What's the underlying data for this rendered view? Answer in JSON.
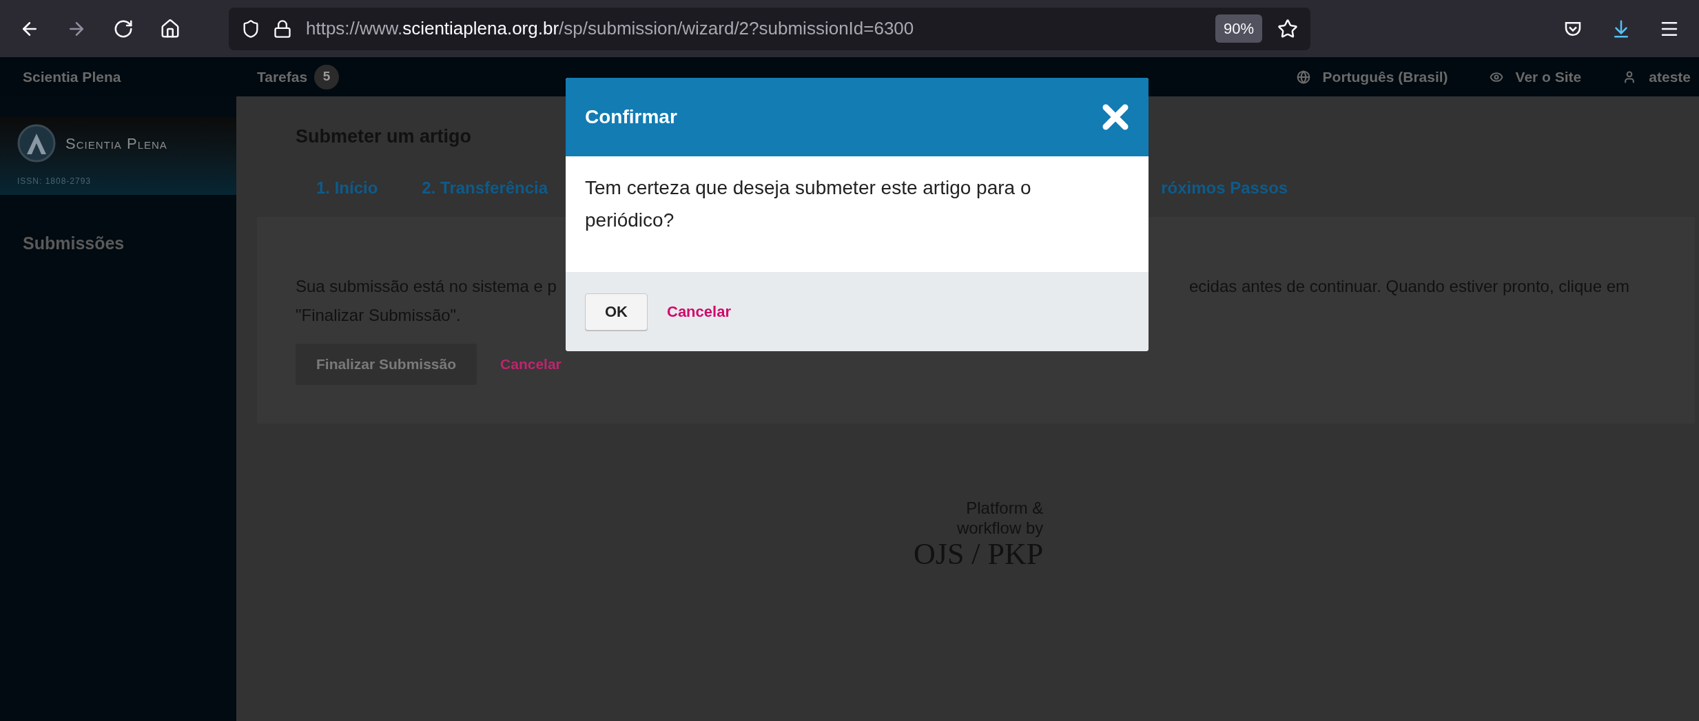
{
  "browser": {
    "nav": [
      {
        "kind": "back",
        "disabled": false
      },
      {
        "kind": "forward",
        "disabled": true
      },
      {
        "kind": "reload",
        "disabled": false
      },
      {
        "kind": "home",
        "disabled": false
      }
    ],
    "url": {
      "prefix": "https://www.",
      "host": "scientiaplena.org.br",
      "path": "/sp/submission/wizard/2?submissionId=6300"
    },
    "zoom": "90%"
  },
  "header": {
    "site_title": "Scientia Plena",
    "tasks": {
      "label": "Tarefas",
      "count": "5"
    },
    "links": [
      {
        "kind": "language",
        "label": "Português (Brasil)"
      },
      {
        "kind": "view",
        "label": "Ver o Site"
      },
      {
        "kind": "user",
        "label": "ateste"
      }
    ]
  },
  "sidebar": {
    "logo": {
      "title": "Scientia Plena",
      "issn": "ISSN: 1808-2793"
    },
    "items": [
      {
        "label": "Submissões"
      }
    ]
  },
  "main": {
    "title": "Submeter um artigo",
    "tabs": [
      {
        "label": "1. Início"
      },
      {
        "label": "2. Transferência"
      },
      {
        "label": "róximos Passos"
      }
    ],
    "paragraph": {
      "line_1_left": "Sua submissão está no sistema e p",
      "line_1_right": "ecidas antes de continuar. Quando estiver pronto, clique em",
      "line_2": "\"Finalizar Submissão\"."
    },
    "buttons": [
      {
        "kind": "primary",
        "label": "Finalizar Submissão"
      },
      {
        "kind": "link",
        "label": "Cancelar"
      }
    ]
  },
  "footer": {
    "lines": [
      "Platform &",
      "workflow by"
    ],
    "brand": "OJS / PKP"
  },
  "dialog": {
    "title": "Confirmar",
    "message": "Tem certeza que deseja submeter este artigo para o periódico?",
    "buttons": [
      {
        "kind": "primary",
        "label": "OK"
      },
      {
        "kind": "link",
        "label": "Cancelar"
      }
    ]
  }
}
